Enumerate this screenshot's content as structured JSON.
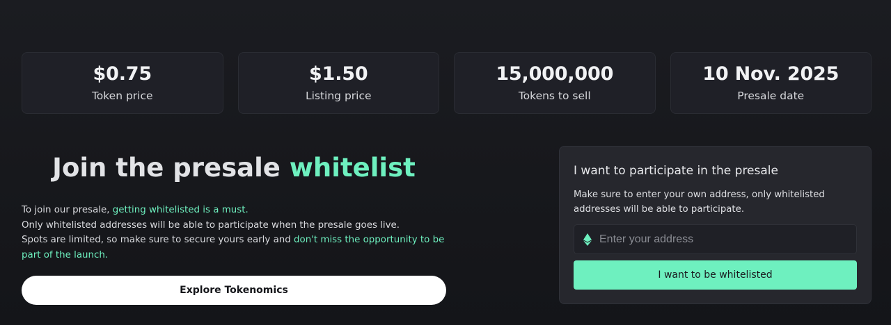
{
  "colors": {
    "background": "#17181c",
    "card": "#1f2027",
    "accent": "#6ef0bf",
    "button_primary": "#ffffff",
    "panel": "#26272d"
  },
  "stats": [
    {
      "value": "$0.75",
      "label": "Token price"
    },
    {
      "value": "$1.50",
      "label": "Listing price"
    },
    {
      "value": "15,000,000",
      "label": "Tokens to sell"
    },
    {
      "value": "10 Nov. 2025",
      "label": "Presale date"
    }
  ],
  "hero": {
    "heading_plain": "Join the presale ",
    "heading_accent": "whitelist",
    "intro": {
      "line1_plain": "To join our presale, ",
      "line1_accent": "getting whitelisted is a must.",
      "line2": "Only whitelisted addresses will be able to participate when the presale goes live.",
      "line3_plain": "Spots are limited, so make sure to secure yours early and ",
      "line3_accent": "don't miss the opportunity to be part of the launch."
    },
    "explore_button_label": "Explore Tokenomics"
  },
  "whitelist_panel": {
    "title": "I want to participate in the presale",
    "description": "Make sure to enter your own address, only whitelisted addresses will be able to participate.",
    "address_input": {
      "placeholder": "Enter your address",
      "value": "",
      "icon": "ethereum-icon"
    },
    "submit_label": "I want to be whitelisted"
  }
}
